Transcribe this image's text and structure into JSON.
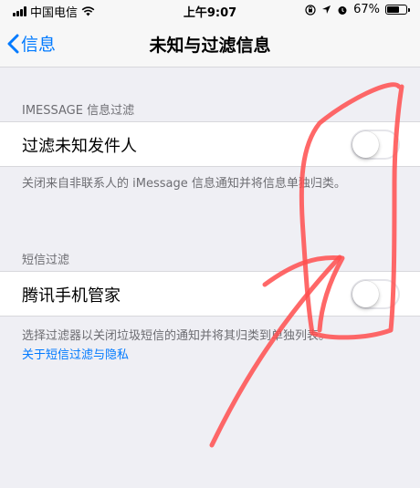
{
  "status_bar": {
    "carrier": "中国电信",
    "time": "上午9:07",
    "battery_percent": "67%",
    "battery_level": 0.67,
    "icons": [
      "signal-icon",
      "wifi-icon",
      "lock-rotation-icon",
      "location-icon",
      "alarm-icon",
      "battery-icon"
    ]
  },
  "nav": {
    "back_label": "信息",
    "title": "未知与过滤信息"
  },
  "imessage_section": {
    "header": "IMESSAGE 信息过滤",
    "row_label": "过滤未知发件人",
    "toggle_on": false,
    "footer": "关闭来自非联系人的 iMessage 信息通知并将信息单独归类。"
  },
  "sms_section": {
    "header": "短信过滤",
    "row_label": "腾讯手机管家",
    "toggle_on": false,
    "footer": "选择过滤器以关闭垃圾短信的通知并将其归类到单独列表。",
    "link": "关于短信过滤与隐私"
  },
  "colors": {
    "accent": "#007aff",
    "background": "#efeff4",
    "annotation": "#ff4d4d"
  }
}
